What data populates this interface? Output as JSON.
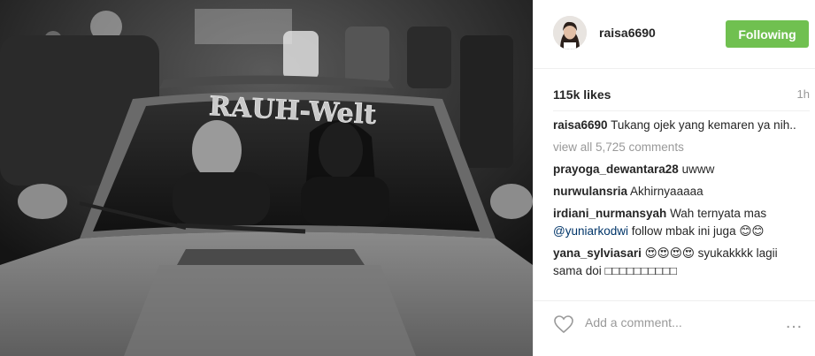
{
  "post": {
    "author": "raisa6690",
    "follow_label": "Following",
    "likes": "115k likes",
    "time_ago": "1h",
    "caption_user": "raisa6690",
    "caption_text": "Tukang ojek yang kemaren ya nih..",
    "view_all": "view all 5,725 comments",
    "add_comment_placeholder": "Add a comment...",
    "more_label": "…"
  },
  "comments": [
    {
      "user": "prayoga_dewantara28",
      "text": "uwww"
    },
    {
      "user": "nurwulansria",
      "text": "Akhirnyaaaaa"
    },
    {
      "user": "irdiani_nurmansyah",
      "text": "Wah ternyata mas",
      "mention": "@yuniarkodwi",
      "text2": "follow mbak ini juga 😊😊"
    },
    {
      "user": "yana_sylviasari",
      "text": "😍😍😍😍 syukakkkk lagii sama doi □□□□□□□□□□"
    }
  ],
  "photo": {
    "windshield_banner": "RAUH-Welt"
  },
  "colors": {
    "follow_green": "#70c050",
    "text_dark": "#262626",
    "text_muted": "#999999",
    "link_blue": "#003569"
  },
  "icons": {
    "like": "heart-outline-icon",
    "more": "more-options-icon"
  }
}
